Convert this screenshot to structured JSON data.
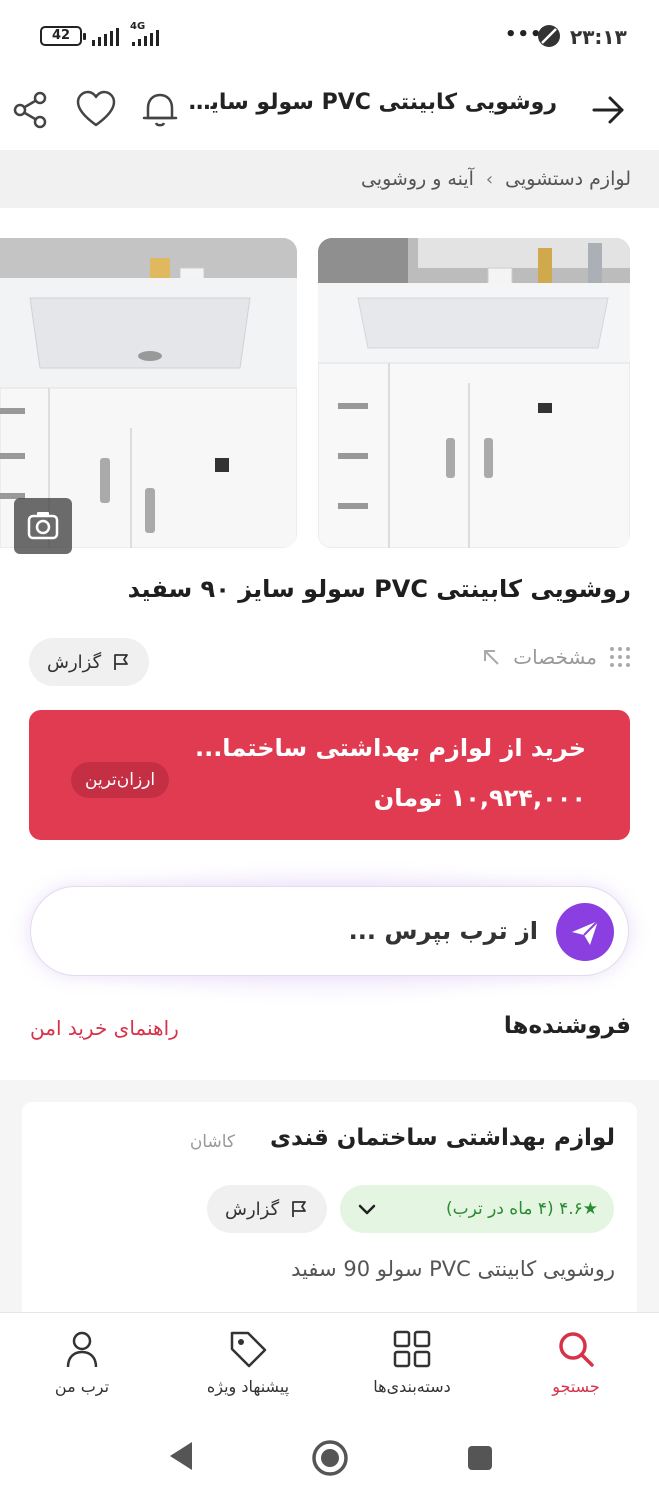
{
  "status_bar": {
    "battery": "42",
    "network": "4G",
    "dots": "•••",
    "time": "۲۳:۱۳"
  },
  "header": {
    "title": "روشویی کابینتی PVC سولو سایز 90 سفید"
  },
  "breadcrumb": {
    "items": [
      "لوازم دستشویی",
      "آینه و روشویی"
    ],
    "separator": "›"
  },
  "product": {
    "title": "روشویی کابینتی PVC سولو سایز ۹۰ سفید"
  },
  "specs": {
    "label": "مشخصات"
  },
  "report": {
    "label": "گزارش"
  },
  "price_card": {
    "shop": "خرید از لوازم بهداشتی ساختما...",
    "price": "۱۰,۹۲۴,۰۰۰ تومان",
    "badge": "ارزان‌ترین",
    "color": "#e03b51"
  },
  "ask": {
    "placeholder": "از ترب بپرس ..."
  },
  "sellers": {
    "title": "فروشنده‌ها",
    "guide_link": "راهنمای خرید امن",
    "items": [
      {
        "name": "لوازم بهداشتی ساختمان قندی",
        "city": "کاشان",
        "rating": "★۴.۶ (۴ ماه در ترب)",
        "report": "گزارش",
        "product": "روشویی کابینتی PVC سولو 90 سفید"
      }
    ]
  },
  "bottom_nav": {
    "items": [
      {
        "label": "جستجو",
        "icon": "search-icon",
        "active": true
      },
      {
        "label": "دسته‌بندی‌ها",
        "icon": "grid-icon",
        "active": false
      },
      {
        "label": "پیشنهاد ویژه",
        "icon": "tag-icon",
        "active": false
      },
      {
        "label": "ترب من",
        "icon": "user-icon",
        "active": false
      }
    ],
    "active_color": "#d83249"
  }
}
